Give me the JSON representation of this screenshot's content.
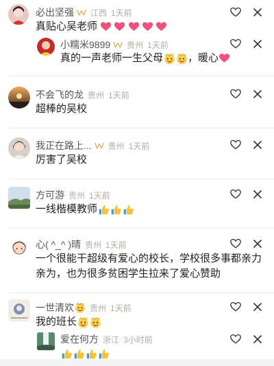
{
  "comments": [
    {
      "username": "必出坚强",
      "location": "江西",
      "time": "1天前",
      "text": "真贴心吴老师",
      "emoji_count": 5,
      "emoji_icon": "heart-icon",
      "reply": {
        "username": "小糯米9899",
        "location": "贵州",
        "time": "1天前",
        "text_before": "真的一声老师一生父母",
        "text_after": "，暖心",
        "icons": [
          "face-icon",
          "face-icon",
          "heart-icon"
        ]
      }
    },
    {
      "username": "不会飞的龙",
      "location": "贵州",
      "time": "1天前",
      "text": "超棒的吴校"
    },
    {
      "username": "我正在路上...",
      "location": "贵州",
      "time": "1天前",
      "text": "厉害了吴校"
    },
    {
      "username": "方可游",
      "location": "贵州",
      "time": "1天前",
      "text": "一线楷模教师",
      "emoji_icon": "thumbs-up-icon",
      "emoji_count": 3
    },
    {
      "username": "心( ^_^ )晴",
      "location": "贵州",
      "time": "1天前",
      "text": "一个很能干超级有爱心的校长，学校很多事都亲力亲为，也为很多贫困学生拉来了爱心赞助"
    },
    {
      "username": "一世清欢",
      "location": "贵州",
      "time": "1天前",
      "text": "我的班长",
      "name_icon": "blushing-face-icon",
      "text_icons": [
        "face-icon",
        "crown-face-icon"
      ],
      "reply": {
        "username": "爱在何方",
        "location": "浙江",
        "time": "3小时前",
        "icons": [
          "thumbs-up-icon",
          "thumbs-up-icon",
          "thumbs-up-icon",
          "thumbs-up-icon"
        ]
      }
    }
  ],
  "colors": {
    "heart": "#f0507a",
    "meta_gray": "#b0aca0",
    "badge_gold": "#d9b25a",
    "thumb_yellow": "#f7c23a"
  }
}
